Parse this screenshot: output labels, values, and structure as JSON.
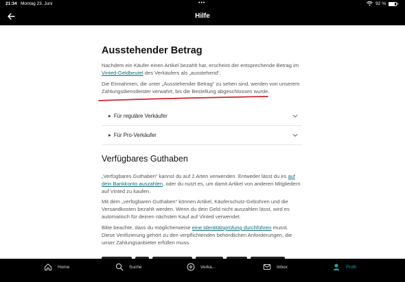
{
  "status_bar": {
    "time": "21:34",
    "date": "Montag 23. Juni",
    "battery": "92 %"
  },
  "app_bar": {
    "title": "Hilfe"
  },
  "page": {
    "heading": "Ausstehender Betrag",
    "intro": {
      "part1": "Nachdem ein Käufer einen Artikel bezahlt hat, erscheint der entsprechende Betrag im ",
      "link": "Vinted-Geldbeutel",
      "part2": " des Verkäufers als „ausstehend“."
    },
    "paragraph2": "Die Einnahmen, die unter „Ausstehender Betrag“ zu sehen sind, werden von unserem Zahlungsdienstleister verwahrt, bis die Bestellung abgeschlossen wurde.",
    "accordions": [
      {
        "label": "Für reguläre Verkäufer"
      },
      {
        "label": "Für Pro-Verkäufer"
      }
    ],
    "heading2": "Verfügbares Guthaben",
    "p3": {
      "part1": "„Verfügbares Guthaben“ kannst du auf 2 Arten verwenden. Entweder lässt du es ",
      "link": "auf dein Bankkonto auszahlen",
      "part2": ", oder du nutzt es, um damit Artikel von anderen Mitgliedern auf Vinted zu kaufen."
    },
    "p4": "Mit dem „verfügbaren Guthaben“ können Artikel, Käuferschutz-Gebühren und die Versandkosten bezahlt werden. Wenn du dein Geld nicht auszahlen lässt, wird es automatisch für deinen nächsten Kauf auf Vinted verwendet.",
    "p5": {
      "part1": "Bitte beachte, dass du möglicherweise ",
      "link": "eine Identitätsprüfung durchführen",
      "part2": " musst. Diese Verifizierung gehört zu den verpflichtenden behördlichen Anforderungen, die unser Zahlungsanbieter erfüllen muss."
    }
  },
  "tabs": [
    {
      "label": "Home",
      "icon": "home-icon"
    },
    {
      "label": "Suche",
      "icon": "search-icon"
    },
    {
      "label": "Verka...",
      "icon": "sell-plus-icon"
    },
    {
      "label": "Inbox",
      "icon": "inbox-icon"
    },
    {
      "label": "Profil",
      "icon": "profile-icon",
      "active": true
    }
  ],
  "colors": {
    "link": "#0a6f7a",
    "active_tab": "#1aa3a8",
    "annotation_red": "#d0232a"
  }
}
